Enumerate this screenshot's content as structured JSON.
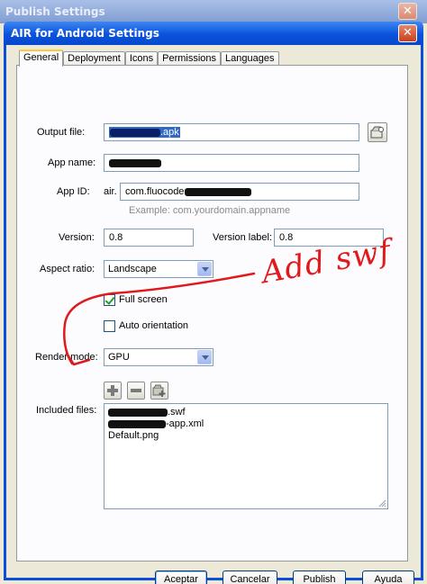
{
  "back_window": {
    "title": "Publish Settings",
    "close_glyph": "✕"
  },
  "dialog": {
    "title": "AIR for Android Settings",
    "close_glyph": "✕"
  },
  "tabs": [
    {
      "label": "General",
      "active": true
    },
    {
      "label": "Deployment",
      "active": false
    },
    {
      "label": "Icons",
      "active": false
    },
    {
      "label": "Permissions",
      "active": false
    },
    {
      "label": "Languages",
      "active": false
    }
  ],
  "form": {
    "output_file": {
      "label": "Output file:",
      "value_suffix": ".apk"
    },
    "app_name": {
      "label": "App name:"
    },
    "app_id": {
      "label": "App ID:",
      "prefix": "air.",
      "value_prefix": "com.fluocode",
      "example": "Example: com.yourdomain.appname"
    },
    "version": {
      "label": "Version:",
      "value": "0.8"
    },
    "version_label": {
      "label": "Version label:",
      "value": "0.8"
    },
    "aspect_ratio": {
      "label": "Aspect ratio:",
      "value": "Landscape"
    },
    "full_screen": {
      "label": "Full screen",
      "checked": true
    },
    "auto_orientation": {
      "label": "Auto orientation",
      "checked": false
    },
    "render_mode": {
      "label": "Render mode:",
      "value": "GPU"
    },
    "included_files": {
      "label": "Included files:",
      "items": [
        {
          "text": ".swf"
        },
        {
          "text": "-app.xml"
        },
        {
          "text": "Default.png"
        }
      ]
    }
  },
  "icons": {
    "browse": "folder-browse-icon",
    "add": "add-file-icon",
    "remove": "remove-file-icon",
    "add_folder": "add-folder-icon"
  },
  "buttons": {
    "accept": "Aceptar",
    "cancel": "Cancelar",
    "publish": "Publish",
    "help": "Ayuda"
  },
  "annotation": {
    "text": "Add swf",
    "color": "#e0191c"
  }
}
